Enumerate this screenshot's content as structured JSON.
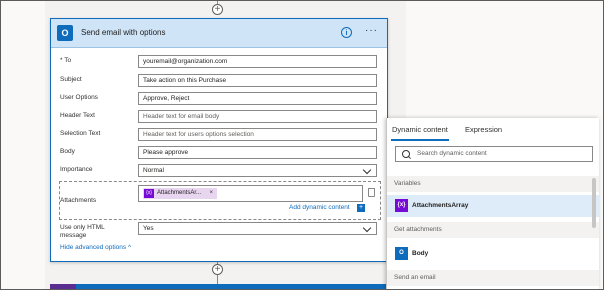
{
  "card": {
    "title": "Send email with options",
    "fields": {
      "to": {
        "label": "* To",
        "value": "youremail@organization.com"
      },
      "subject": {
        "label": "Subject",
        "value": "Take action on this Purchase"
      },
      "user_options": {
        "label": "User Options",
        "value": "Approve, Reject"
      },
      "header_text": {
        "label": "Header Text",
        "placeholder": "Header text for email body"
      },
      "selection_text": {
        "label": "Selection Text",
        "placeholder": "Header text for users options selection"
      },
      "body": {
        "label": "Body",
        "value": "Please approve"
      },
      "importance": {
        "label": "Importance",
        "value": "Normal"
      },
      "attachments": {
        "label": "Attachments",
        "token": "AttachmentsAr...",
        "token_icon": "{x}"
      },
      "html_message": {
        "label_line1": "Use only HTML",
        "label_line2": "message",
        "value": "Yes"
      }
    },
    "add_dynamic_content": "Add dynamic content",
    "hide_advanced": "Hide advanced options",
    "logo_letter": "O"
  },
  "panel": {
    "tabs": [
      "Dynamic content",
      "Expression"
    ],
    "search_placeholder": "Search dynamic content",
    "sections": {
      "variables": "Variables",
      "get_attachments": "Get attachments",
      "send_email": "Send an email"
    },
    "items": {
      "attachments_array": {
        "label": "AttachmentsArray",
        "icon": "{x}"
      },
      "body": {
        "label": "Body",
        "icon": "O"
      }
    }
  },
  "colors": {
    "accent": "#0f6cbd",
    "variable_purple": "#770bd6",
    "selected_row": "#deecf9"
  }
}
